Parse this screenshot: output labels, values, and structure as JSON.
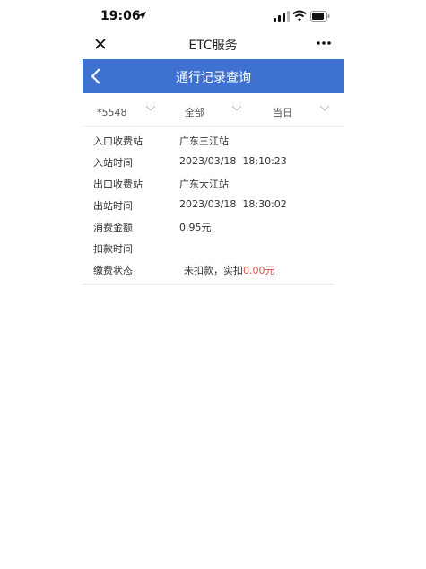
{
  "status_bar": {
    "time": "19:06"
  },
  "mp_nav": {
    "title": "ETC服务"
  },
  "header": {
    "title": "通行记录查询"
  },
  "filters": [
    {
      "label": "*5548"
    },
    {
      "label": "全部"
    },
    {
      "label": "当日"
    }
  ],
  "details": {
    "entry_station": {
      "label": "入口收费站",
      "value": "广东三江站"
    },
    "entry_time": {
      "label": "入站时间",
      "value": "2023/03/18  18:10:23"
    },
    "exit_station": {
      "label": "出口收费站",
      "value": "广东大江站"
    },
    "exit_time": {
      "label": "出站时间",
      "value": "2023/03/18  18:30:02"
    },
    "amount": {
      "label": "消费金额",
      "value": "0.95元"
    },
    "deduct_time": {
      "label": "扣款时间",
      "value": ""
    },
    "payment_status": {
      "label": "缴费状态",
      "value_prefix": "未扣款，实扣",
      "value_amount": "0.00元"
    }
  },
  "colors": {
    "header_blue": "#3f72d0",
    "amount_red": "#d9534f"
  }
}
